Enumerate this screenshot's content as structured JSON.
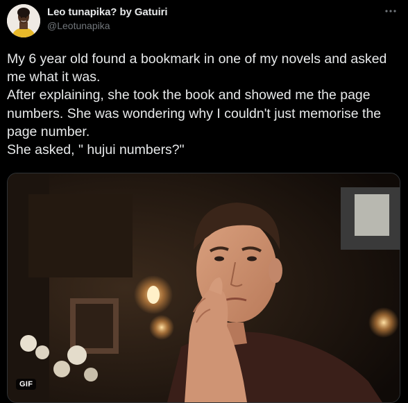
{
  "tweet": {
    "display_name": "Leo tunapika? by Gatuiri",
    "handle": "@Leotunapika",
    "text": "My 6 year old found a bookmark in one of my novels and asked me what it was.\nAfter explaining, she took the book and showed me the page numbers. She was wondering why I couldn't just memorise the page number.\nShe asked, \" hujui numbers?\"",
    "more_icon": "more-horizontal-icon"
  },
  "media": {
    "badge": "GIF"
  },
  "colors": {
    "background": "#000000",
    "text": "#e7e9ea",
    "secondary_text": "#71767b"
  }
}
